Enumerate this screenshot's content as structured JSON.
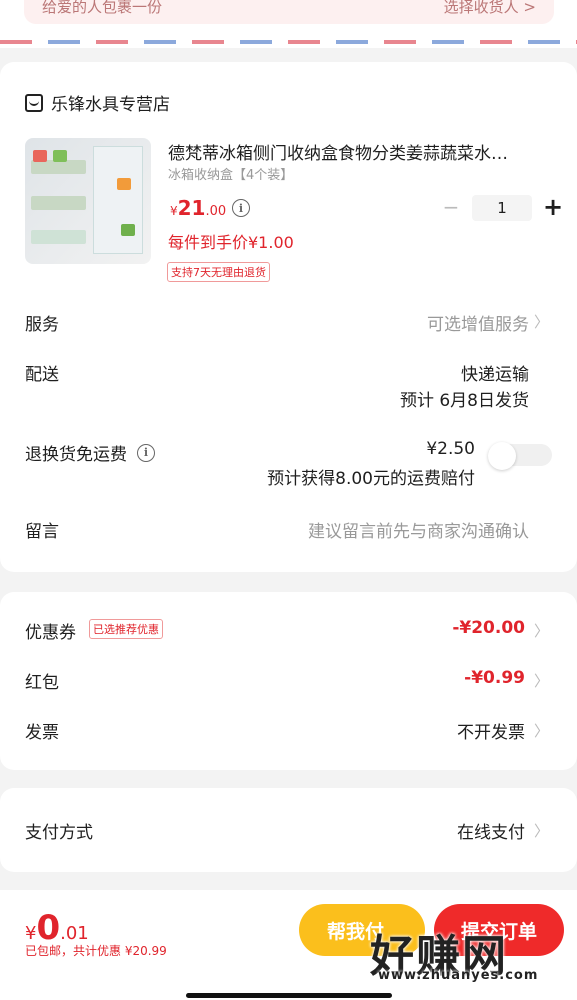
{
  "address": {
    "left_text": "给爱的人包裹一份",
    "right_text": "选择收货人 >"
  },
  "shop": {
    "name": "乐锋水具专营店",
    "product": {
      "title": "德梵蒂冰箱侧门收纳盒食物分类姜蒜蔬菜水…",
      "sku": "冰箱收纳盒【4个装】",
      "price_currency": "¥",
      "price_int": "21",
      "price_dec": ".00",
      "unit_price": "每件到手价¥1.00",
      "return_tag": "支持7天无理由退货",
      "quantity": "1"
    },
    "rows": {
      "service_label": "服务",
      "service_value": "可选增值服务",
      "delivery_label": "配送",
      "delivery_method": "快递运输",
      "delivery_date": "预计 6月8日发货",
      "freight_label": "退换货免运费",
      "freight_price": "¥2.50",
      "freight_note": "预计获得8.00元的运费赔付",
      "freight_enabled": false,
      "message_label": "留言",
      "message_placeholder": "建议留言前先与商家沟通确认"
    }
  },
  "discounts": {
    "coupon_label": "优惠券",
    "coupon_tag": "已选推荐优惠",
    "coupon_value": "-¥20.00",
    "redpacket_label": "红包",
    "redpacket_value": "-¥0.99",
    "invoice_label": "发票",
    "invoice_value": "不开发票"
  },
  "payment": {
    "label": "支付方式",
    "value": "在线支付"
  },
  "footer": {
    "total_currency": "¥",
    "total_int": "0",
    "total_dec": ".01",
    "total_sub": "已包邮，共计优惠 ¥20.99",
    "help_button": "帮我付",
    "submit_button": "提交订单"
  },
  "watermark": {
    "text": "好赚网",
    "sub": "www.zhuanyes.com"
  },
  "colors": {
    "accent_red": "#e0242c",
    "help_yellow": "#fbbf1c",
    "submit_red": "#ef2a2a"
  }
}
